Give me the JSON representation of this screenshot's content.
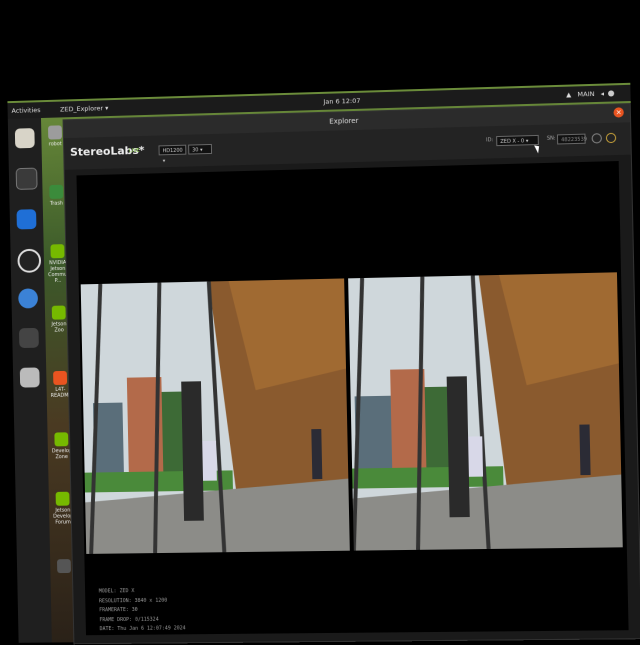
{
  "desktop": {
    "activities": "Activities",
    "app_menu": "ZED_Explorer ▾",
    "clock": "Jan 6  12:07",
    "tray": {
      "user": "MAIN"
    }
  },
  "dock": {
    "items": [
      {
        "icon": "files-icon"
      },
      {
        "icon": "terminal-icon"
      },
      {
        "icon": "vscode-icon"
      },
      {
        "icon": "obs-icon"
      },
      {
        "icon": "chromium-icon"
      },
      {
        "icon": "app-icon"
      },
      {
        "icon": "drive-icon"
      }
    ]
  },
  "desktop_icons": [
    {
      "label": "robot",
      "color": "#9c9c9c"
    },
    {
      "label": "Trash",
      "color": "#3b8b3b"
    },
    {
      "label": "NVIDIA Jetson Community P...",
      "color": "#76b900"
    },
    {
      "label": "Jetson Zoo",
      "color": "#76b900"
    },
    {
      "label": "L4T-README",
      "color": "#e95420"
    },
    {
      "label": "Developer Zone",
      "color": "#76b900"
    },
    {
      "label": "Jetson Developer Forum",
      "color": "#76b900"
    },
    {
      "label": "",
      "color": "#555"
    }
  ],
  "window": {
    "title": "Explorer",
    "close": "×"
  },
  "toolbar": {
    "brand": "StereoLabs*",
    "live": "LIVE",
    "resolution": "HD1200 ▾",
    "fps": "30 ▾",
    "id_label": "ID:",
    "id_value": "ZED X - 0  ▾",
    "sn_label": "SN:",
    "sn_value": "48223539"
  },
  "info": {
    "lines": [
      "MODEL: ZED X",
      "RESOLUTION: 3840 x 1200",
      "FRAMERATE: 30",
      "FRAME DROP: 0/115324",
      "DATE: Thu Jan 6 12:07:49 2024"
    ]
  }
}
